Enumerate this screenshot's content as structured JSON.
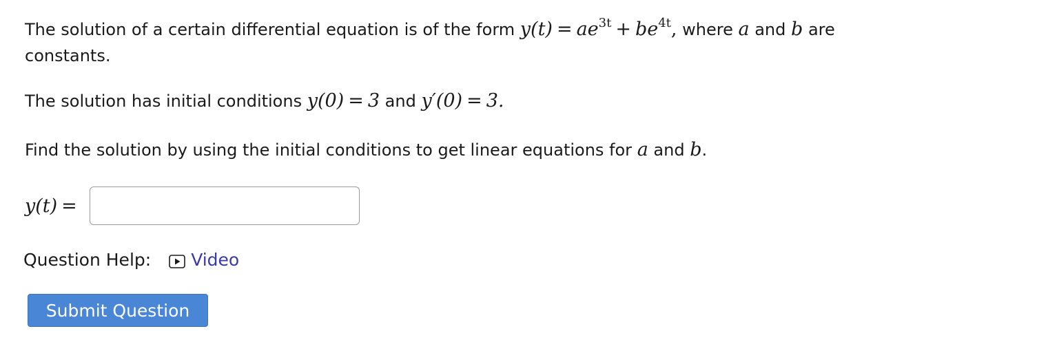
{
  "question": {
    "p1": {
      "text_before": "The solution of a certain differential equation is of the form ",
      "eq_lhs": "y(t)",
      "eq_equals": "=",
      "term1_coef": "ae",
      "term1_exp": "3t",
      "plus": "+",
      "term2_coef": "be",
      "term2_exp": "4t",
      "comma": ",",
      "text_mid": " where ",
      "var_a": "a",
      "text_and": " and ",
      "var_b": "b",
      "text_after": " are",
      "line2": "constants."
    },
    "p2": {
      "text_before": "The solution has initial conditions ",
      "cond1": "y(0)",
      "eq1": "=",
      "val1": "3",
      "text_and": " and ",
      "cond2": "y′(0)",
      "eq2": "=",
      "val2": "3."
    },
    "p3": {
      "text_before": "Find the solution by using the initial conditions to get linear equations for ",
      "var_a": "a",
      "text_and": " and ",
      "var_b": "b",
      "period": "."
    }
  },
  "answer": {
    "label": "y(t)",
    "equals": "=",
    "value": "",
    "placeholder": ""
  },
  "help": {
    "label": "Question Help:",
    "video_label": "Video",
    "video_icon": "play-video-icon"
  },
  "submit": {
    "label": "Submit Question"
  },
  "colors": {
    "link": "#3a3aa8",
    "button_bg": "#4a86d6",
    "button_text": "#ffffff",
    "input_border": "#9a9a9a"
  }
}
